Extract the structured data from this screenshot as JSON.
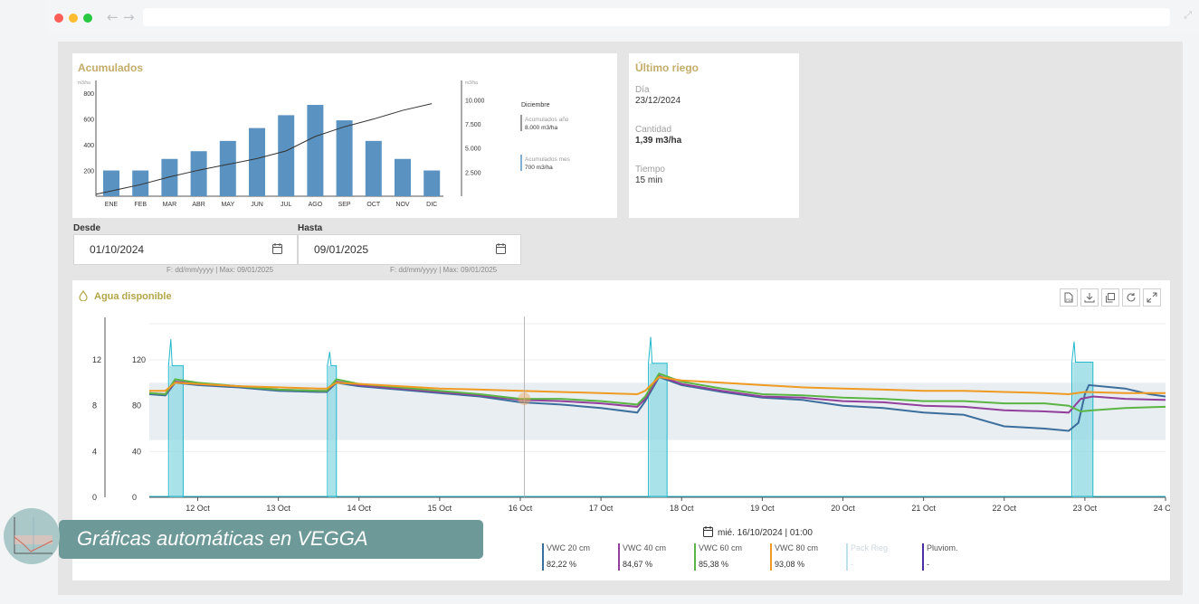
{
  "browser": {
    "back_glyph": "←",
    "forward_glyph": "→",
    "expand_glyph": "⤢"
  },
  "acumulados": {
    "title": "Acumulados",
    "left_unit": "m3/ha",
    "right_unit": "m3/ha",
    "chart_data": {
      "type": "bar",
      "categories": [
        "ENE",
        "FEB",
        "MAR",
        "ABR",
        "MAY",
        "JUN",
        "JUL",
        "AGO",
        "SEP",
        "OCT",
        "NOV",
        "DIC"
      ],
      "series": [
        {
          "name": "Acumulados mes",
          "values": [
            200,
            200,
            290,
            350,
            430,
            530,
            630,
            710,
            590,
            430,
            290,
            200
          ],
          "color": "#5a93c2"
        },
        {
          "name": "Acumulados año",
          "values": [
            200,
            1200,
            2000,
            2700,
            3300,
            3900,
            4700,
            6200,
            7200,
            8000,
            8900,
            9600
          ],
          "color": "#333333"
        }
      ],
      "y_ticks_left": [
        "800",
        "600",
        "400",
        "200"
      ],
      "y_ticks_right": [
        "10.000",
        "7.500",
        "5.000",
        "2.500"
      ],
      "ylim_left": [
        0,
        900
      ],
      "ylim_right": [
        0,
        12000
      ],
      "legend": {
        "month": "Diciembre",
        "year_label": "Acumulados año",
        "year_value": "8.000 m3/ha",
        "month_label": "Acumulados mes",
        "month_value": "700 m3/ha"
      }
    }
  },
  "ultimo_riego": {
    "title": "Último riego",
    "dia_label": "Día",
    "dia_value": "23/12/2024",
    "cantidad_label": "Cantidad",
    "cantidad_value": "1,39 m3/ha",
    "tiempo_label": "Tiempo",
    "tiempo_value": "15 min"
  },
  "filters": {
    "desde_label": "Desde",
    "desde_value": "01/10/2024",
    "desde_hint": "F: dd/mm/yyyy | Max: 09/01/2025",
    "hasta_label": "Hasta",
    "hasta_value": "09/01/2025",
    "hasta_hint": "F: dd/mm/yyyy | Max: 09/01/2025"
  },
  "agua": {
    "title": "Agua disponible",
    "chart_data": {
      "type": "line",
      "x_ticks": [
        "12 Oct",
        "13 Oct",
        "14 Oct",
        "15 Oct",
        "16 Oct",
        "17 Oct",
        "18 Oct",
        "19 Oct",
        "20 Oct",
        "21 Oct",
        "22 Oct",
        "23 Oct",
        "24 Oct"
      ],
      "y_ticks_left": [
        "12",
        "8",
        "4",
        "0"
      ],
      "y_ticks_inner": [
        "120",
        "80",
        "40",
        "0"
      ],
      "ylim_inner": [
        0,
        150
      ],
      "band": [
        50,
        100
      ],
      "tooltip_date": "mié. 16/10/2024 | 01:00",
      "cursor_day": 16.05,
      "series": [
        {
          "name": "VWC 20 cm",
          "value": "82,22 %",
          "color": "#3b6e9c",
          "points": [
            [
              11.4,
              90
            ],
            [
              11.6,
              89
            ],
            [
              11.72,
              100
            ],
            [
              12.0,
              98
            ],
            [
              12.5,
              96
            ],
            [
              13.0,
              93
            ],
            [
              13.5,
              92
            ],
            [
              13.6,
              92
            ],
            [
              13.72,
              100
            ],
            [
              14.0,
              97
            ],
            [
              14.5,
              94
            ],
            [
              15.0,
              91
            ],
            [
              15.5,
              88
            ],
            [
              16.0,
              83
            ],
            [
              16.5,
              81
            ],
            [
              17.0,
              78
            ],
            [
              17.45,
              74
            ],
            [
              17.55,
              84
            ],
            [
              17.72,
              105
            ],
            [
              18.0,
              98
            ],
            [
              18.5,
              92
            ],
            [
              19.0,
              87
            ],
            [
              19.5,
              85
            ],
            [
              20.0,
              80
            ],
            [
              20.5,
              78
            ],
            [
              21.0,
              74
            ],
            [
              21.5,
              72
            ],
            [
              21.8,
              66
            ],
            [
              22.0,
              62
            ],
            [
              22.5,
              60
            ],
            [
              22.8,
              58
            ],
            [
              22.92,
              65
            ],
            [
              23.0,
              90
            ],
            [
              23.05,
              98
            ],
            [
              23.5,
              95
            ],
            [
              23.8,
              90
            ],
            [
              24.0,
              88
            ]
          ]
        },
        {
          "name": "VWC 40 cm",
          "value": "84,67 %",
          "color": "#93409c",
          "points": [
            [
              11.4,
              91
            ],
            [
              11.6,
              90
            ],
            [
              11.72,
              101
            ],
            [
              12.0,
              99
            ],
            [
              12.5,
              97
            ],
            [
              13.0,
              94
            ],
            [
              13.5,
              93
            ],
            [
              13.6,
              93
            ],
            [
              13.72,
              101
            ],
            [
              14.0,
              98
            ],
            [
              14.5,
              95
            ],
            [
              15.0,
              92
            ],
            [
              15.5,
              89
            ],
            [
              16.0,
              85
            ],
            [
              16.5,
              84
            ],
            [
              17.0,
              82
            ],
            [
              17.45,
              79
            ],
            [
              17.55,
              86
            ],
            [
              17.72,
              106
            ],
            [
              18.0,
              99
            ],
            [
              18.5,
              93
            ],
            [
              19.0,
              88
            ],
            [
              19.5,
              87
            ],
            [
              20.0,
              84
            ],
            [
              20.5,
              83
            ],
            [
              21.0,
              80
            ],
            [
              21.5,
              79
            ],
            [
              22.0,
              76
            ],
            [
              22.5,
              75
            ],
            [
              22.8,
              74
            ],
            [
              22.95,
              86
            ],
            [
              23.1,
              88
            ],
            [
              23.5,
              86
            ],
            [
              24.0,
              85
            ]
          ]
        },
        {
          "name": "VWC 60 cm",
          "value": "85,38 %",
          "color": "#5ab544",
          "points": [
            [
              11.4,
              91
            ],
            [
              11.6,
              90
            ],
            [
              11.72,
              103
            ],
            [
              12.0,
              100
            ],
            [
              12.5,
              97
            ],
            [
              13.0,
              94
            ],
            [
              13.5,
              93
            ],
            [
              13.6,
              93
            ],
            [
              13.72,
              103
            ],
            [
              14.0,
              99
            ],
            [
              14.5,
              96
            ],
            [
              15.0,
              93
            ],
            [
              15.5,
              90
            ],
            [
              16.0,
              86
            ],
            [
              16.5,
              86
            ],
            [
              17.0,
              84
            ],
            [
              17.45,
              81
            ],
            [
              17.55,
              88
            ],
            [
              17.72,
              108
            ],
            [
              18.0,
              101
            ],
            [
              18.5,
              95
            ],
            [
              19.0,
              90
            ],
            [
              19.5,
              89
            ],
            [
              20.0,
              87
            ],
            [
              20.5,
              86
            ],
            [
              21.0,
              84
            ],
            [
              21.5,
              84
            ],
            [
              22.0,
              82
            ],
            [
              22.5,
              82
            ],
            [
              22.8,
              80
            ],
            [
              22.95,
              75
            ],
            [
              23.1,
              76
            ],
            [
              23.5,
              78
            ],
            [
              24.0,
              79
            ]
          ]
        },
        {
          "name": "VWC 80 cm",
          "value": "93,08 %",
          "color": "#ef9a22",
          "points": [
            [
              11.4,
              93
            ],
            [
              11.6,
              93
            ],
            [
              11.72,
              100
            ],
            [
              12.0,
              99
            ],
            [
              12.5,
              97
            ],
            [
              13.0,
              96
            ],
            [
              13.5,
              95
            ],
            [
              13.6,
              95
            ],
            [
              13.72,
              100
            ],
            [
              14.0,
              99
            ],
            [
              14.5,
              97
            ],
            [
              15.0,
              95
            ],
            [
              15.5,
              94
            ],
            [
              16.0,
              93
            ],
            [
              16.5,
              92
            ],
            [
              17.0,
              91
            ],
            [
              17.45,
              90
            ],
            [
              17.55,
              93
            ],
            [
              17.72,
              105
            ],
            [
              18.0,
              102
            ],
            [
              18.5,
              100
            ],
            [
              19.0,
              98
            ],
            [
              19.5,
              96
            ],
            [
              20.0,
              95
            ],
            [
              20.5,
              94
            ],
            [
              21.0,
              93
            ],
            [
              21.5,
              93
            ],
            [
              22.0,
              92
            ],
            [
              22.5,
              91
            ],
            [
              22.8,
              90
            ],
            [
              23.0,
              92
            ],
            [
              23.5,
              91
            ],
            [
              24.0,
              91
            ]
          ]
        },
        {
          "name": "Pack Rieg",
          "value": "-",
          "color": "#bfe0ee",
          "points": []
        },
        {
          "name": "Pluviom.",
          "value": "-",
          "color": "#4d2fa3",
          "points": []
        }
      ],
      "irrigation_events": [
        {
          "start": 11.65,
          "end": 11.82,
          "level": 115,
          "peak": 138
        },
        {
          "start": 13.62,
          "end": 13.72,
          "level": 115,
          "peak": 127
        },
        {
          "start": 17.6,
          "end": 17.82,
          "level": 117,
          "peak": 140
        },
        {
          "start": 22.85,
          "end": 23.1,
          "level": 118,
          "peak": 136
        }
      ]
    }
  },
  "overlay": {
    "caption": "Gráficas automáticas en VEGGA"
  }
}
